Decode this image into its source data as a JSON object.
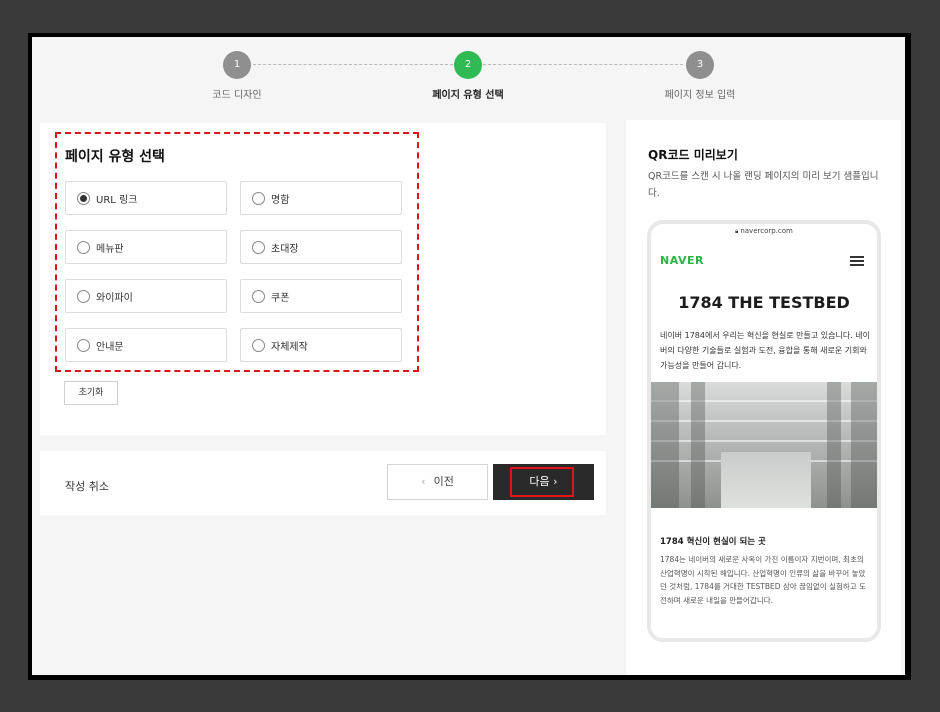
{
  "stepper": {
    "steps": [
      {
        "number": "1",
        "label": "코드 디자인",
        "state": "done"
      },
      {
        "number": "2",
        "label": "페이지 유형 선택",
        "state": "active"
      },
      {
        "number": "3",
        "label": "페이지 정보 입력",
        "state": "pending"
      }
    ]
  },
  "page_type": {
    "title": "페이지 유형 선택",
    "options": [
      {
        "label": "URL 링크",
        "checked": true
      },
      {
        "label": "명함",
        "checked": false
      },
      {
        "label": "메뉴판",
        "checked": false
      },
      {
        "label": "초대장",
        "checked": false
      },
      {
        "label": "와이파이",
        "checked": false
      },
      {
        "label": "쿠폰",
        "checked": false
      },
      {
        "label": "안내문",
        "checked": false
      },
      {
        "label": "자체제작",
        "checked": false
      }
    ],
    "reset_label": "초기화"
  },
  "actions": {
    "cancel_label": "작성 취소",
    "prev_label": "이전",
    "next_label": "다음"
  },
  "preview": {
    "title": "QR코드 미리보기",
    "description": "QR코드를 스캔 시 나올 랜딩 페이지의 미리 보기 샘플입니다.",
    "phone": {
      "url": "navercorp.com",
      "logo": "NAVER",
      "headline": "1784 THE TESTBED",
      "intro": "네이버 1784에서 우리는 혁신을 현실로 만들고 있습니다. 네이버의 다양한 기술들로 실험과 도전, 융합을 통해 새로운 기회와 가능성을 만들어 갑니다.",
      "subheading": "1784 혁신이 현실이 되는 곳",
      "body": "1784는 네이버의 새로운 사옥이 가진 이름이자 지번이며, 최초의 산업혁명이 시작된 해입니다. 산업혁명이 인류의 삶을 바꾸어 놓았던 것처럼, 1784를 거대한 TESTBED 삼아 끊임없이 실험하고 도전하며 새로운 내일을 만들어갑니다."
    }
  },
  "colors": {
    "active_step": "#2fba54",
    "inactive_step": "#8f8f8f",
    "highlight": "#d9171b",
    "naver_green": "#2fb24a",
    "primary_button": "#2a2a2a"
  }
}
